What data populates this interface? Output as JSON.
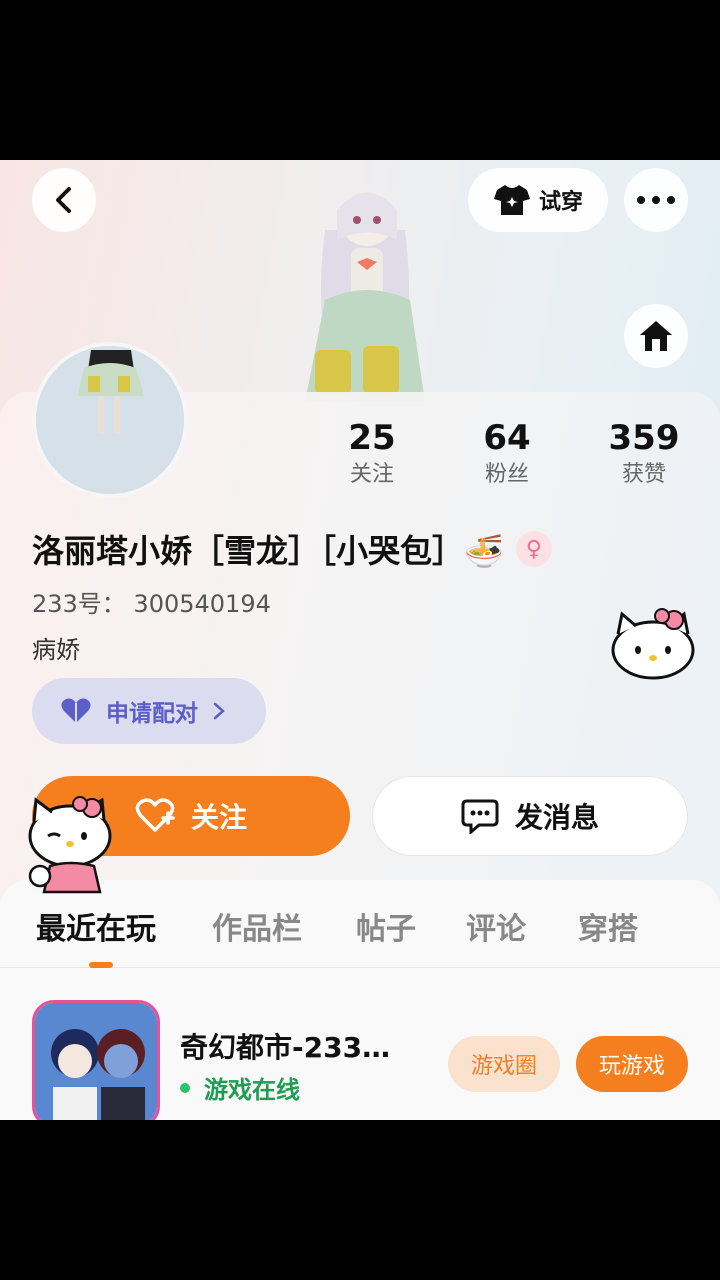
{
  "header": {
    "back_icon": "chevron-left-icon",
    "try_on_label": "试穿",
    "try_on_icon": "tshirt-icon",
    "more_icon": "more-horizontal-icon",
    "home_icon": "home-icon"
  },
  "profile": {
    "stats": [
      {
        "value": "25",
        "label": "关注"
      },
      {
        "value": "64",
        "label": "粉丝"
      },
      {
        "value": "359",
        "label": "获赞"
      }
    ],
    "name": "洛丽塔小娇［雪龙］［小哭包］🍜",
    "gender_symbol": "♀",
    "uid": "233号： 300540194",
    "bio": "病娇",
    "pair_button": "申请配对",
    "follow_button": "关注",
    "message_button": "发消息"
  },
  "tabs": [
    "最近在玩",
    "作品栏",
    "帖子",
    "评论",
    "穿搭"
  ],
  "active_tab": "最近在玩",
  "game": {
    "title": "奇幻都市-233…",
    "status": "游戏在线",
    "circle_button": "游戏圈",
    "play_button": "玩游戏"
  },
  "colors": {
    "accent": "#f57f1f",
    "pair": "#5b5fc7",
    "online": "#1e9e53"
  }
}
